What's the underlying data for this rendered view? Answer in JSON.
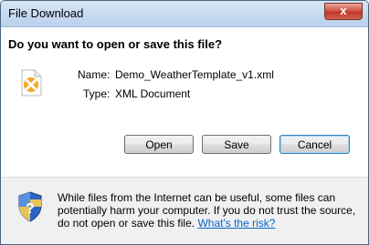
{
  "window": {
    "title": "File Download",
    "close_label": "x"
  },
  "dialog": {
    "question": "Do you want to open or save this file?",
    "file_icon": "xml-file-icon",
    "name_label": "Name:",
    "name_value": "Demo_WeatherTemplate_v1.xml",
    "type_label": "Type:",
    "type_value": "XML Document"
  },
  "buttons": {
    "open": "Open",
    "save": "Save",
    "cancel": "Cancel"
  },
  "info": {
    "icon": "security-shield-icon",
    "text": "While files from the Internet can be useful, some files can potentially harm your computer. If you do not trust the source, do not open or save this file.",
    "link": "What's the risk?"
  },
  "colors": {
    "titlebar": "#c9dcf1",
    "close_button": "#c0352a",
    "link": "#0066cc",
    "info_background": "#f0f0f0"
  }
}
